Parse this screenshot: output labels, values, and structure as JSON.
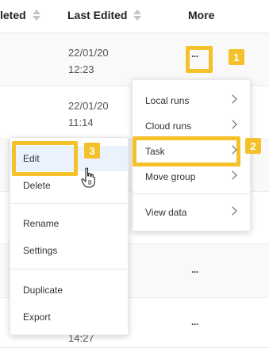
{
  "header": {
    "col_completed": "leted",
    "col_last_edited": "Last Edited",
    "col_more": "More"
  },
  "rows": [
    {
      "date": "22/01/20",
      "time": "12:23"
    },
    {
      "date": "22/01/20",
      "time": "11:14"
    },
    {
      "time": "14:27"
    }
  ],
  "more_icon": "···",
  "submenu": {
    "items": [
      "Local runs",
      "Cloud runs",
      "Task",
      "Move group",
      "View data"
    ]
  },
  "context_menu": {
    "items": [
      "Edit",
      "Delete",
      "Rename",
      "Settings",
      "Duplicate",
      "Export"
    ]
  },
  "callouts": [
    "1",
    "2",
    "3"
  ],
  "colors": {
    "callout": "#f4c12a",
    "highlight": "#eaf3fd"
  },
  "icons": [
    "sort-icon",
    "more-icon",
    "chevron-right-icon",
    "hand-cursor-icon"
  ]
}
